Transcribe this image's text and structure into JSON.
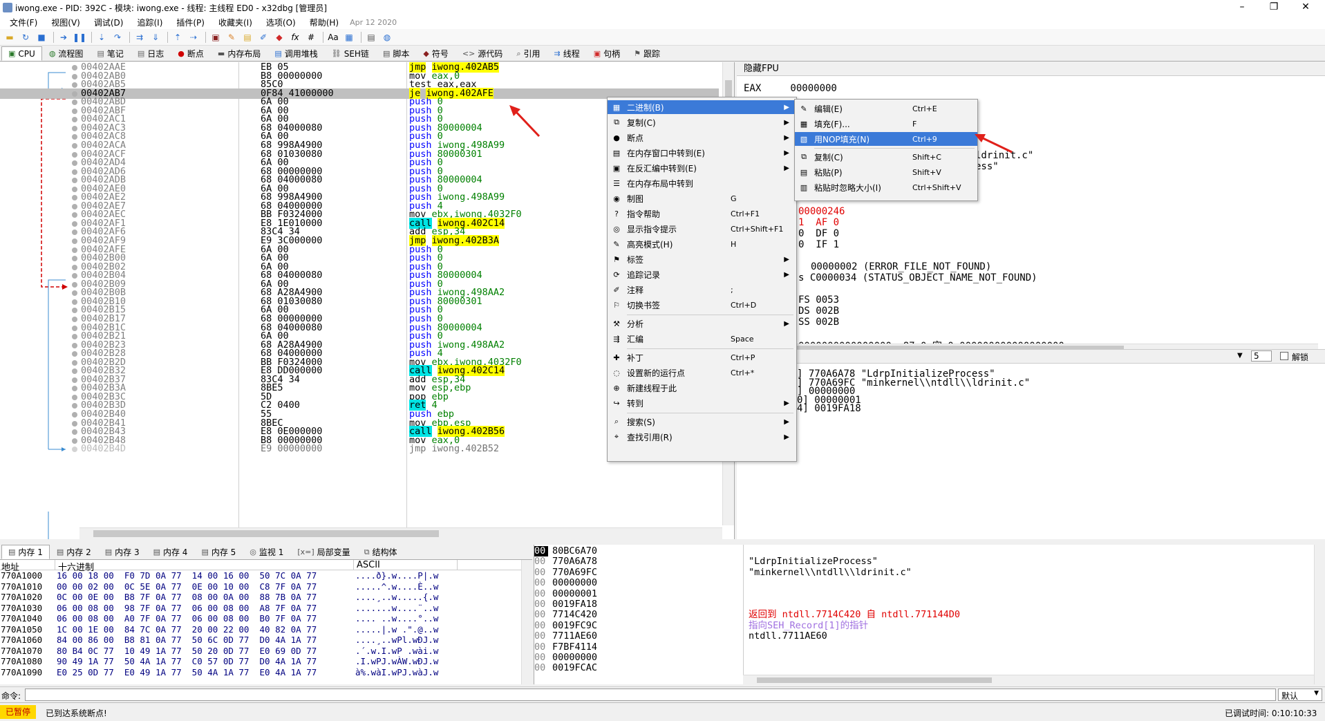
{
  "title": "iwong.exe - PID: 392C - 模块: iwong.exe - 线程: 主线程 ED0 - x32dbg [管理员]",
  "menu": [
    "文件(F)",
    "视图(V)",
    "调试(D)",
    "追踪(I)",
    "插件(P)",
    "收藏夹(I)",
    "选项(O)",
    "帮助(H)"
  ],
  "date": "Apr 12 2020",
  "tabs": [
    "CPU",
    "流程图",
    "笔记",
    "日志",
    "断点",
    "内存布局",
    "调用堆栈",
    "SEH链",
    "脚本",
    "符号",
    "源代码",
    "引用",
    "线程",
    "句柄",
    "跟踪"
  ],
  "disasm": [
    {
      "addr": "00402AAE",
      "bytes": "EB 05",
      "mn": "jmp",
      "op": "iwong.402AB5",
      "kind": "jmp"
    },
    {
      "addr": "00402AB0",
      "bytes": "B8 00000000",
      "mn": "mov",
      "op": "eax,0",
      "kind": "mov"
    },
    {
      "addr": "00402AB5",
      "bytes": "85C0",
      "mn": "test",
      "op": "eax,eax",
      "kind": "plain"
    },
    {
      "addr": "00402AB7",
      "bytes": "0F84 41000000",
      "mn": "je",
      "op": "iwong.402AFE",
      "kind": "je"
    },
    {
      "addr": "00402ABD",
      "bytes": "6A 00",
      "mn": "push",
      "op": "0",
      "kind": "push"
    },
    {
      "addr": "00402ABF",
      "bytes": "6A 00",
      "mn": "push",
      "op": "0",
      "kind": "push"
    },
    {
      "addr": "00402AC1",
      "bytes": "6A 00",
      "mn": "push",
      "op": "0",
      "kind": "push"
    },
    {
      "addr": "00402AC3",
      "bytes": "68 04000080",
      "mn": "push",
      "op": "80000004",
      "kind": "push"
    },
    {
      "addr": "00402AC8",
      "bytes": "6A 00",
      "mn": "push",
      "op": "0",
      "kind": "push"
    },
    {
      "addr": "00402ACA",
      "bytes": "68 998A4900",
      "mn": "push",
      "op": "iwong.498A99",
      "kind": "push"
    },
    {
      "addr": "00402ACF",
      "bytes": "68 01030080",
      "mn": "push",
      "op": "80000301",
      "kind": "push"
    },
    {
      "addr": "00402AD4",
      "bytes": "6A 00",
      "mn": "push",
      "op": "0",
      "kind": "push"
    },
    {
      "addr": "00402AD6",
      "bytes": "68 00000000",
      "mn": "push",
      "op": "0",
      "kind": "push"
    },
    {
      "addr": "00402ADB",
      "bytes": "68 04000080",
      "mn": "push",
      "op": "80000004",
      "kind": "push"
    },
    {
      "addr": "00402AE0",
      "bytes": "6A 00",
      "mn": "push",
      "op": "0",
      "kind": "push"
    },
    {
      "addr": "00402AE2",
      "bytes": "68 998A4900",
      "mn": "push",
      "op": "iwong.498A99",
      "kind": "push"
    },
    {
      "addr": "00402AE7",
      "bytes": "68 04000000",
      "mn": "push",
      "op": "4",
      "kind": "push"
    },
    {
      "addr": "00402AEC",
      "bytes": "BB F0324000",
      "mn": "mov",
      "op": "ebx,iwong.4032F0",
      "kind": "mov"
    },
    {
      "addr": "00402AF1",
      "bytes": "E8 1E010000",
      "mn": "call",
      "op": "iwong.402C14",
      "kind": "call"
    },
    {
      "addr": "00402AF6",
      "bytes": "83C4 34",
      "mn": "add",
      "op": "esp,34",
      "kind": "mov"
    },
    {
      "addr": "00402AF9",
      "bytes": "E9 3C000000",
      "mn": "jmp",
      "op": "iwong.402B3A",
      "kind": "jmp"
    },
    {
      "addr": "00402AFE",
      "bytes": "6A 00",
      "mn": "push",
      "op": "0",
      "kind": "push"
    },
    {
      "addr": "00402B00",
      "bytes": "6A 00",
      "mn": "push",
      "op": "0",
      "kind": "push"
    },
    {
      "addr": "00402B02",
      "bytes": "6A 00",
      "mn": "push",
      "op": "0",
      "kind": "push"
    },
    {
      "addr": "00402B04",
      "bytes": "68 04000080",
      "mn": "push",
      "op": "80000004",
      "kind": "push"
    },
    {
      "addr": "00402B09",
      "bytes": "6A 00",
      "mn": "push",
      "op": "0",
      "kind": "push"
    },
    {
      "addr": "00402B0B",
      "bytes": "68 A28A4900",
      "mn": "push",
      "op": "iwong.498AA2",
      "kind": "push"
    },
    {
      "addr": "00402B10",
      "bytes": "68 01030080",
      "mn": "push",
      "op": "80000301",
      "kind": "push"
    },
    {
      "addr": "00402B15",
      "bytes": "6A 00",
      "mn": "push",
      "op": "0",
      "kind": "push"
    },
    {
      "addr": "00402B17",
      "bytes": "68 00000000",
      "mn": "push",
      "op": "0",
      "kind": "push"
    },
    {
      "addr": "00402B1C",
      "bytes": "68 04000080",
      "mn": "push",
      "op": "80000004",
      "kind": "push"
    },
    {
      "addr": "00402B21",
      "bytes": "6A 00",
      "mn": "push",
      "op": "0",
      "kind": "push"
    },
    {
      "addr": "00402B23",
      "bytes": "68 A28A4900",
      "mn": "push",
      "op": "iwong.498AA2",
      "kind": "push"
    },
    {
      "addr": "00402B28",
      "bytes": "68 04000000",
      "mn": "push",
      "op": "4",
      "kind": "push"
    },
    {
      "addr": "00402B2D",
      "bytes": "BB F0324000",
      "mn": "mov",
      "op": "ebx,iwong.4032F0",
      "kind": "mov"
    },
    {
      "addr": "00402B32",
      "bytes": "E8 DD000000",
      "mn": "call",
      "op": "iwong.402C14",
      "kind": "call"
    },
    {
      "addr": "00402B37",
      "bytes": "83C4 34",
      "mn": "add",
      "op": "esp,34",
      "kind": "mov"
    },
    {
      "addr": "00402B3A",
      "bytes": "8BE5",
      "mn": "mov",
      "op": "esp,ebp",
      "kind": "mov"
    },
    {
      "addr": "00402B3C",
      "bytes": "5D",
      "mn": "pop",
      "op": "ebp",
      "kind": "mov"
    },
    {
      "addr": "00402B3D",
      "bytes": "C2 0400",
      "mn": "ret",
      "op": "4",
      "kind": "ret"
    },
    {
      "addr": "00402B40",
      "bytes": "55",
      "mn": "push",
      "op": "ebp",
      "kind": "push"
    },
    {
      "addr": "00402B41",
      "bytes": "8BEC",
      "mn": "mov",
      "op": "ebp,esp",
      "kind": "mov"
    },
    {
      "addr": "00402B43",
      "bytes": "E8 0E000000",
      "mn": "call",
      "op": "iwong.402B56",
      "kind": "call"
    },
    {
      "addr": "00402B48",
      "bytes": "B8 00000000",
      "mn": "mov",
      "op": "eax,0",
      "kind": "mov"
    },
    {
      "addr": "00402B4D",
      "bytes": "E9 00000000",
      "mn": "jmp",
      "op": "iwong.402B52",
      "kind": "jmpg"
    }
  ],
  "regs": {
    "header": "隐藏FPU",
    "eax": "EAX     00000000",
    "r1": "ldrinit.c\"",
    "r2": "ess\"",
    "eflags": "00000246",
    "f1": "1  AF 0",
    "f2": "0  DF 0",
    "f3": "0  IF 1",
    "err1": "00000002 (ERROR_FILE_NOT_FOUND)",
    "err2": "s C0000034 (STATUS_OBJECT_NAME_NOT_FOUND)",
    "fs": "FS 0053",
    "ds": "DS 002B",
    "ss": "SS 002B",
    "x87": "0000000000000000 x87r0 空 0.000000000000000000",
    "argcount": "5",
    "unlock": "解锁"
  },
  "args": [
    "] 770A6A78 \"LdrpInitializeProcess\"",
    "] 770A69FC \"minkernel\\\\ntdll\\\\ldrinit.c\"",
    "] 00000000",
    "0] 00000001",
    "4] 0019FA18"
  ],
  "dump_tabs": [
    "内存 1",
    "内存 2",
    "内存 3",
    "内存 4",
    "内存 5",
    "监视 1",
    "局部变量",
    "结构体"
  ],
  "dump_headers": [
    "地址",
    "十六进制",
    "ASCII"
  ],
  "dump": [
    {
      "a": "770A1000",
      "h": "16 00 18 00  F0 7D 0A 77  14 00 16 00  50 7C 0A 77",
      "s": "....ð}.w....P|.w"
    },
    {
      "a": "770A1010",
      "h": "00 00 02 00  0C 5E 0A 77  0E 00 10 00  C8 7F 0A 77",
      "s": ".....^.w....È..w"
    },
    {
      "a": "770A1020",
      "h": "0C 00 0E 00  B8 7F 0A 77  08 00 0A 00  88 7B 0A 77",
      "s": "....¸..w.....{.w"
    },
    {
      "a": "770A1030",
      "h": "06 00 08 00  98 7F 0A 77  06 00 08 00  A8 7F 0A 77",
      "s": ".......w....¨..w"
    },
    {
      "a": "770A1040",
      "h": "06 00 08 00  A0 7F 0A 77  06 00 08 00  B0 7F 0A 77",
      "s": ".... ..w....°..w"
    },
    {
      "a": "770A1050",
      "h": "1C 00 1E 00  84 7C 0A 77  20 00 22 00  40 82 0A 77",
      "s": ".....|.w .\".@..w"
    },
    {
      "a": "770A1060",
      "h": "84 00 86 00  B8 81 0A 77  50 6C 0D 77  D0 4A 1A 77",
      "s": "....¸..wPl.wÐJ.w"
    },
    {
      "a": "770A1070",
      "h": "80 B4 0C 77  10 49 1A 77  50 20 0D 77  E0 69 0D 77",
      "s": ".´.w.I.wP .wài.w"
    },
    {
      "a": "770A1080",
      "h": "90 49 1A 77  50 4A 1A 77  C0 57 0D 77  D0 4A 1A 77",
      "s": ".I.wPJ.wÀW.wÐJ.w"
    },
    {
      "a": "770A1090",
      "h": "E0 25 0D 77  E0 49 1A 77  50 4A 1A 77  E0 4A 1A 77",
      "s": "à%.wàI.wPJ.wàJ.w"
    }
  ],
  "stack": [
    {
      "a": "80BC6A70",
      "v": "",
      "sel": true
    },
    {
      "a": "770A6A78",
      "v": "\"LdrpInitializeProcess\""
    },
    {
      "a": "770A69FC",
      "v": "\"minkernel\\\\ntdll\\\\ldrinit.c\""
    },
    {
      "a": "00000000",
      "v": ""
    },
    {
      "a": "00000001",
      "v": ""
    },
    {
      "a": "0019FA18",
      "v": ""
    },
    {
      "a": "7714C420",
      "v": "返回到 ntdll.7714C420 自 ntdll.771144D0",
      "c": "red"
    },
    {
      "a": "0019FC9C",
      "v": "指向SEH_Record[1]的指针",
      "c": "purple"
    },
    {
      "a": "7711AE60",
      "v": "ntdll.7711AE60"
    },
    {
      "a": "F7BF4114",
      "v": ""
    },
    {
      "a": "00000000",
      "v": ""
    },
    {
      "a": "0019FCAC",
      "v": ""
    }
  ],
  "cmd": {
    "label": "命令:",
    "default": "默认"
  },
  "status": {
    "paused": "已暂停",
    "msg": "已到达系统断点!",
    "time": "已调试时间:  0:10:10:33"
  },
  "ctx_main": [
    {
      "icon": "▦",
      "label": "二进制(B)",
      "sc": "",
      "sub": true
    },
    {
      "icon": "⧉",
      "label": "复制(C)",
      "sc": "",
      "sub": true
    },
    {
      "icon": "●",
      "label": "断点",
      "sc": "",
      "sub": true
    },
    {
      "icon": "▤",
      "label": "在内存窗口中转到(E)",
      "sc": "",
      "sub": true
    },
    {
      "icon": "▣",
      "label": "在反汇编中转到(E)",
      "sc": "",
      "sub": true
    },
    {
      "icon": "☰",
      "label": "在内存布局中转到",
      "sc": "",
      "sub": false
    },
    {
      "icon": "◉",
      "label": "制图",
      "sc": "G",
      "sub": false
    },
    {
      "icon": "?",
      "label": "指令帮助",
      "sc": "Ctrl+F1",
      "sub": false
    },
    {
      "icon": "◎",
      "label": "显示指令提示",
      "sc": "Ctrl+Shift+F1",
      "sub": false
    },
    {
      "icon": "✎",
      "label": "高亮模式(H)",
      "sc": "H",
      "sub": false
    },
    {
      "icon": "⚑",
      "label": "标签",
      "sc": "",
      "sub": true
    },
    {
      "icon": "⟳",
      "label": "追踪记录",
      "sc": "",
      "sub": true
    },
    {
      "icon": "✐",
      "label": "注释",
      "sc": ";",
      "sub": false
    },
    {
      "icon": "⚐",
      "label": "切换书签",
      "sc": "Ctrl+D",
      "sub": false
    },
    {
      "icon": "⚒",
      "label": "分析",
      "sc": "",
      "sub": true
    },
    {
      "icon": "⇶",
      "label": "汇编",
      "sc": "Space",
      "sub": false
    },
    {
      "icon": "✚",
      "label": "补丁",
      "sc": "Ctrl+P",
      "sub": false
    },
    {
      "icon": "◌",
      "label": "设置新的运行点",
      "sc": "Ctrl+*",
      "sub": false
    },
    {
      "icon": "⊕",
      "label": "新建线程于此",
      "sc": "",
      "sub": false
    },
    {
      "icon": "↪",
      "label": "转到",
      "sc": "",
      "sub": true
    },
    {
      "icon": "⌕",
      "label": "搜索(S)",
      "sc": "",
      "sub": true
    },
    {
      "icon": "⌖",
      "label": "查找引用(R)",
      "sc": "",
      "sub": true
    }
  ],
  "ctx_sub": [
    {
      "icon": "✎",
      "label": "编辑(E)",
      "sc": "Ctrl+E"
    },
    {
      "icon": "▦",
      "label": "填充(F)...",
      "sc": "F"
    },
    {
      "icon": "▧",
      "label": "用NOP填充(N)",
      "sc": "Ctrl+9"
    },
    {
      "icon": "⧉",
      "label": "复制(C)",
      "sc": "Shift+C"
    },
    {
      "icon": "▤",
      "label": "粘贴(P)",
      "sc": "Shift+V"
    },
    {
      "icon": "▥",
      "label": "粘贴时忽略大小(I)",
      "sc": "Ctrl+Shift+V"
    }
  ]
}
